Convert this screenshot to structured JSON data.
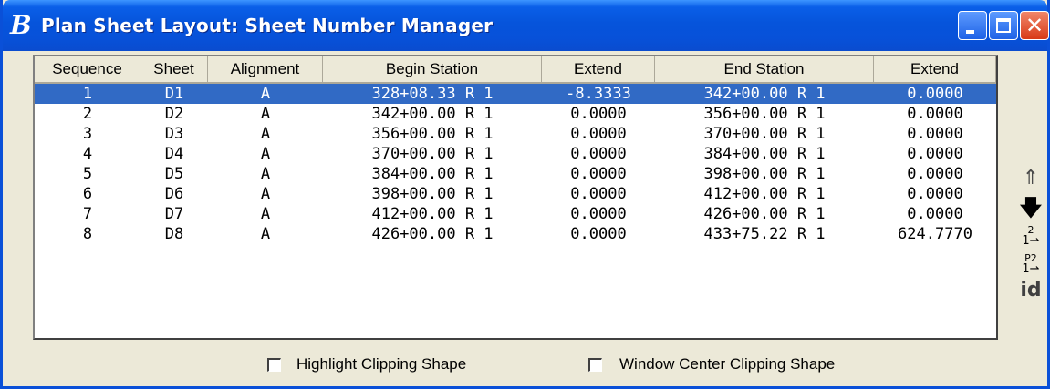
{
  "window": {
    "title": "Plan Sheet Layout: Sheet Number Manager",
    "app_icon_glyph": "B",
    "app_icon": "bentley-b-icon",
    "titlebar_buttons": {
      "minimize_icon": "minimize-icon",
      "maximize_icon": "maximize-icon",
      "close_icon": "close-icon",
      "close_glyph": "✕"
    },
    "colors": {
      "titlebar": "#0654db",
      "selection": "#316ac5",
      "window_bg": "#ece9d8",
      "close_button": "#d83a17"
    }
  },
  "table": {
    "columns": [
      "Sequence",
      "Sheet",
      "Alignment",
      "Begin Station",
      "Extend",
      "End Station",
      "Extend"
    ],
    "selected_row": 0,
    "rows": [
      [
        "1",
        "D1",
        "A",
        "328+08.33 R 1",
        "-8.3333",
        "342+00.00 R 1",
        "0.0000"
      ],
      [
        "2",
        "D2",
        "A",
        "342+00.00 R 1",
        "0.0000",
        "356+00.00 R 1",
        "0.0000"
      ],
      [
        "3",
        "D3",
        "A",
        "356+00.00 R 1",
        "0.0000",
        "370+00.00 R 1",
        "0.0000"
      ],
      [
        "4",
        "D4",
        "A",
        "370+00.00 R 1",
        "0.0000",
        "384+00.00 R 1",
        "0.0000"
      ],
      [
        "5",
        "D5",
        "A",
        "384+00.00 R 1",
        "0.0000",
        "398+00.00 R 1",
        "0.0000"
      ],
      [
        "6",
        "D6",
        "A",
        "398+00.00 R 1",
        "0.0000",
        "412+00.00 R 1",
        "0.0000"
      ],
      [
        "7",
        "D7",
        "A",
        "412+00.00 R 1",
        "0.0000",
        "426+00.00 R 1",
        "0.0000"
      ],
      [
        "8",
        "D8",
        "A",
        "426+00.00 R 1",
        "0.0000",
        "433+75.22 R 1",
        "624.7770"
      ]
    ]
  },
  "side_toolbar": {
    "move_up": {
      "icon": "move-up-icon",
      "glyph": "⇑"
    },
    "move_down": {
      "icon": "move-down-icon",
      "glyph": "🡇"
    },
    "renumber": {
      "icon": "renumber-icon",
      "glyph_top": "2",
      "glyph_bottom": "1⇀"
    },
    "prefix_renumber": {
      "icon": "prefix-renumber-icon",
      "glyph_top": "P2",
      "glyph_bottom": "1⇀"
    },
    "identify": {
      "icon": "identify-icon",
      "glyph": "id"
    }
  },
  "options": {
    "highlight_clipping_shape": {
      "label": "Highlight Clipping Shape",
      "checked": false
    },
    "window_center_clipping_shape": {
      "label": "Window Center Clipping Shape",
      "checked": false
    }
  }
}
